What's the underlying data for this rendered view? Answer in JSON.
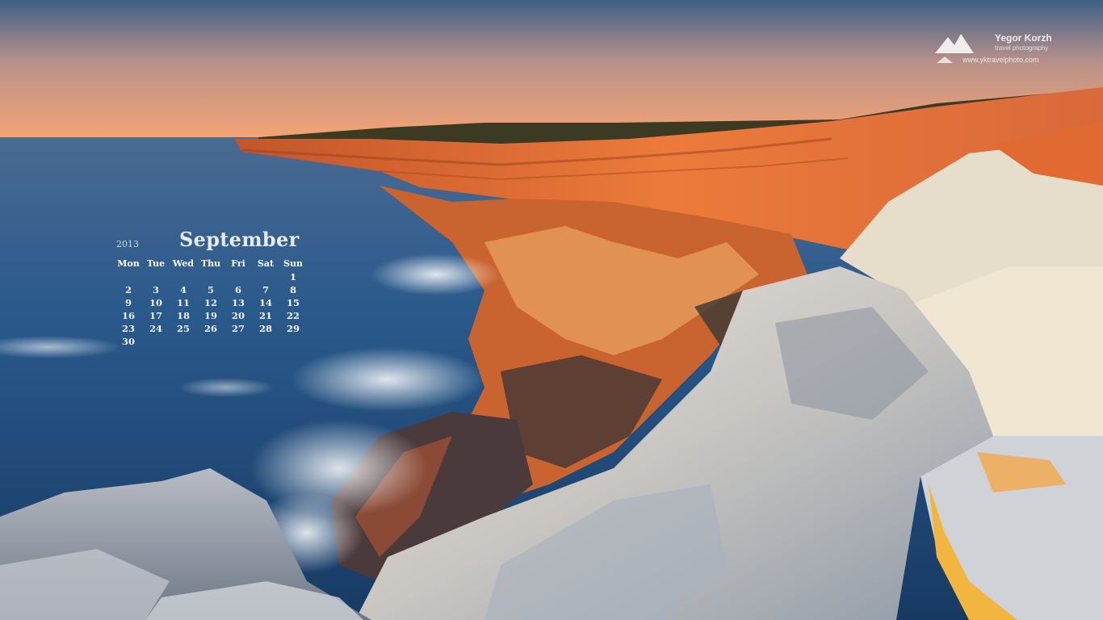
{
  "watermark": {
    "name": "Yegor Korzh",
    "tagline": "travel photography",
    "url": "www.yktravelphoto.com"
  },
  "calendar": {
    "year": "2013",
    "month": "September",
    "weekdays": [
      "Mon",
      "Tue",
      "Wed",
      "Thu",
      "Fri",
      "Sat",
      "Sun"
    ],
    "weeks": [
      [
        "",
        "",
        "",
        "",
        "",
        "",
        "1"
      ],
      [
        "2",
        "3",
        "4",
        "5",
        "6",
        "7",
        "8"
      ],
      [
        "9",
        "10",
        "11",
        "12",
        "13",
        "14",
        "15"
      ],
      [
        "16",
        "17",
        "18",
        "19",
        "20",
        "21",
        "22"
      ],
      [
        "23",
        "24",
        "25",
        "26",
        "27",
        "28",
        "29"
      ],
      [
        "30",
        "",
        "",
        "",
        "",
        "",
        ""
      ]
    ]
  },
  "colors": {
    "sky_top": "#3f5f86",
    "sky_bottom": "#f4a373",
    "sea": "#1f4a78",
    "cliff_sunlit": "#e8743a",
    "rock_pale": "#d9d4c9"
  }
}
